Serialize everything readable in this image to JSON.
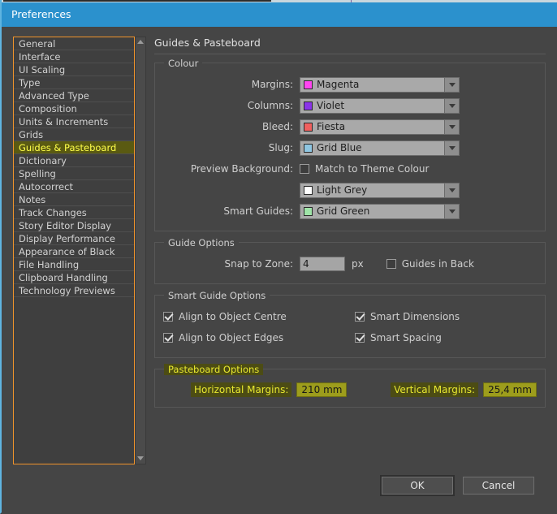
{
  "window": {
    "title": "Preferences"
  },
  "sidebar": {
    "items": [
      {
        "label": "General",
        "selected": false
      },
      {
        "label": "Interface",
        "selected": false
      },
      {
        "label": "UI Scaling",
        "selected": false
      },
      {
        "label": "Type",
        "selected": false
      },
      {
        "label": "Advanced Type",
        "selected": false
      },
      {
        "label": "Composition",
        "selected": false
      },
      {
        "label": "Units & Increments",
        "selected": false
      },
      {
        "label": "Grids",
        "selected": false
      },
      {
        "label": "Guides & Pasteboard",
        "selected": true
      },
      {
        "label": "Dictionary",
        "selected": false
      },
      {
        "label": "Spelling",
        "selected": false
      },
      {
        "label": "Autocorrect",
        "selected": false
      },
      {
        "label": "Notes",
        "selected": false
      },
      {
        "label": "Track Changes",
        "selected": false
      },
      {
        "label": "Story Editor Display",
        "selected": false
      },
      {
        "label": "Display Performance",
        "selected": false
      },
      {
        "label": "Appearance of Black",
        "selected": false
      },
      {
        "label": "File Handling",
        "selected": false
      },
      {
        "label": "Clipboard Handling",
        "selected": false
      },
      {
        "label": "Technology Previews",
        "selected": false
      }
    ],
    "scrollbar": {
      "up_arrow": "scroll-up-arrow",
      "down_arrow": "scroll-down-arrow"
    }
  },
  "panel": {
    "title": "Guides & Pasteboard",
    "colour": {
      "legend": "Colour",
      "rows": [
        {
          "label": "Margins:",
          "value": "Magenta",
          "swatch": "#ff45f0"
        },
        {
          "label": "Columns:",
          "value": "Violet",
          "swatch": "#8a34e8"
        },
        {
          "label": "Bleed:",
          "value": "Fiesta",
          "swatch": "#f0605e"
        },
        {
          "label": "Slug:",
          "value": "Grid Blue",
          "swatch": "#8fc6e2"
        }
      ],
      "preview_background": {
        "label": "Preview Background:",
        "checkbox_label": "Match to Theme Colour",
        "checked": false,
        "value": "Light Grey",
        "swatch": "#ffffff"
      },
      "smart_guides": {
        "label": "Smart Guides:",
        "value": "Grid Green",
        "swatch": "#9fe4a8"
      }
    },
    "guide_options": {
      "legend": "Guide Options",
      "snap_label": "Snap to Zone:",
      "snap_value": "4",
      "snap_unit": "px",
      "guides_in_back_label": "Guides in Back",
      "guides_in_back_checked": false
    },
    "smart_guide_options": {
      "legend": "Smart Guide Options",
      "checks": [
        {
          "label": "Align to Object Centre",
          "checked": true
        },
        {
          "label": "Smart Dimensions",
          "checked": true
        },
        {
          "label": "Align to Object Edges",
          "checked": true
        },
        {
          "label": "Smart Spacing",
          "checked": true
        }
      ]
    },
    "pasteboard_options": {
      "legend": "Pasteboard Options",
      "horizontal_label": "Horizontal Margins:",
      "horizontal_value": "210 mm",
      "vertical_label": "Vertical Margins:",
      "vertical_value": "25,4 mm"
    }
  },
  "buttons": {
    "ok": "OK",
    "cancel": "Cancel"
  },
  "colors": {
    "titlebar": "#2b91cd",
    "window_bg": "#454545",
    "selection": "#5a5a12",
    "selection_text": "#ffff4a",
    "list_border": "#f0932b",
    "highlight_bg": "#4c4c14",
    "highlight_text": "#e8e830",
    "highlight_field": "#9d9d1c"
  }
}
